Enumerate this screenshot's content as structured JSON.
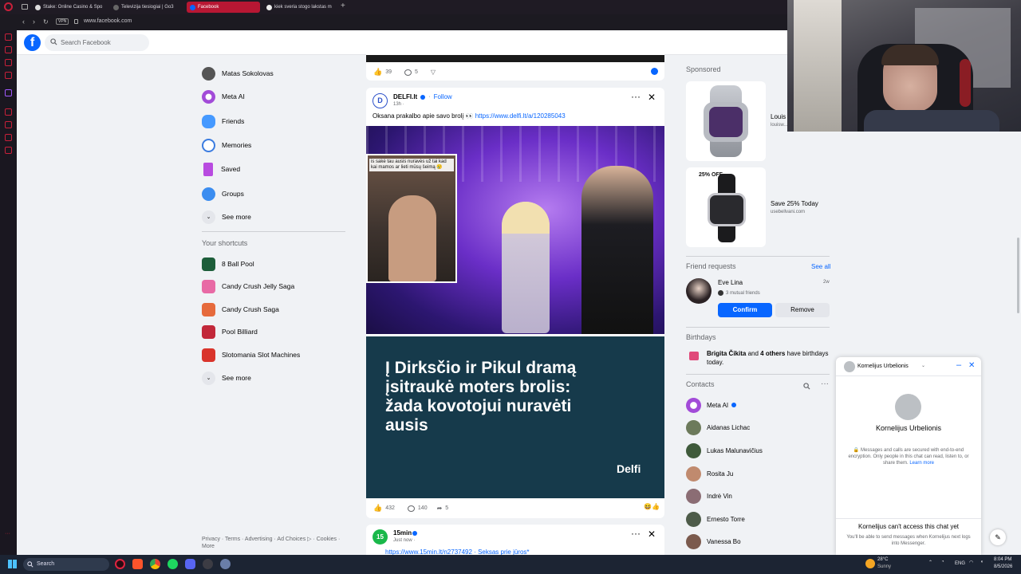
{
  "browser": {
    "tabs": [
      {
        "label": "Stake: Online Casino & Spo",
        "active": false
      },
      {
        "label": "Televizija tiesiogiai | Go3",
        "active": false
      },
      {
        "label": "Facebook",
        "active": true
      },
      {
        "label": "kiek sveria stogo lakstas m",
        "active": false
      }
    ],
    "new_tab": "+",
    "vpn": "VPN",
    "url": "www.facebook.com"
  },
  "facebook": {
    "logo": "f",
    "search_placeholder": "Search Facebook",
    "nav_icons": [
      "home-icon",
      "video-icon",
      "marketplace-icon",
      "groups-icon",
      "gaming-icon"
    ],
    "left_nav": [
      {
        "label": "Matas Sokolovas",
        "icon": "profile-avatar"
      },
      {
        "label": "Meta AI",
        "icon": "meta-ai-icon"
      },
      {
        "label": "Friends",
        "icon": "friends-icon"
      },
      {
        "label": "Memories",
        "icon": "memories-icon"
      },
      {
        "label": "Saved",
        "icon": "saved-icon"
      },
      {
        "label": "Groups",
        "icon": "groups-icon"
      },
      {
        "label": "See more",
        "icon": "chevron-down-icon"
      }
    ],
    "shortcuts_title": "Your shortcuts",
    "shortcuts": [
      {
        "label": "8 Ball Pool"
      },
      {
        "label": "Candy Crush Jelly Saga"
      },
      {
        "label": "Candy Crush Saga"
      },
      {
        "label": "Pool Billiard"
      },
      {
        "label": "Slotomania Slot Machines"
      },
      {
        "label": "See more"
      }
    ],
    "footer": "Privacy · Terms · Advertising · Ad Choices ▷ · Cookies · More",
    "prev_post": {
      "likes": "39",
      "comments": "5"
    },
    "post": {
      "author": "DELFI.lt",
      "follow": "Follow",
      "time": "13h ·",
      "text": "Oksana prakalbo apie savo brolį 👀",
      "link": "https://www.delfi.lt/a/120285043",
      "overlay_text": "is sakė tau ausis nuravės už tai kad kai mamos ar lieti mūsų šeimą 😢",
      "headline": "Į Dirksčio ir Pikul dramą įsitraukė moters brolis: žada kovotojui nuravėti ausis",
      "brand": "Delfi",
      "likes": "432",
      "comments": "140",
      "shares": "5"
    },
    "next_post": {
      "author": "15min",
      "time": "Just now ·",
      "text": "https://www.15min.lt/n2737492 · Seksas prie jūros*"
    },
    "sponsored_title": "Sponsored",
    "ads": [
      {
        "name": "Louis",
        "url": "louisw..."
      },
      {
        "name": "Save 25% Today",
        "url": "usebellvani.com",
        "badge": "25% OFF"
      }
    ],
    "friend_requests": {
      "title": "Friend requests",
      "see_all": "See all",
      "name": "Eve Lina",
      "time": "2w",
      "mutual": "3 mutual friends",
      "confirm": "Confirm",
      "remove": "Remove"
    },
    "birthdays": {
      "title": "Birthdays",
      "name": "Brigita Čikita",
      "rest": " and ",
      "others": "4 others",
      "tail": " have birthdays today."
    },
    "contacts_title": "Contacts",
    "contacts": [
      {
        "name": "Meta AI",
        "color": "#a24bd8"
      },
      {
        "name": "Aidanas Lichac",
        "color": "#6c7a5b"
      },
      {
        "name": "Lukas Malunavičius",
        "color": "#3f5a3b"
      },
      {
        "name": "Rosita Ju",
        "color": "#c08a6e"
      },
      {
        "name": "Indrė Vin",
        "color": "#8b6d74"
      },
      {
        "name": "Ernesto Torre",
        "color": "#4d5b49"
      },
      {
        "name": "Vanessa Bo",
        "color": "#7b5a4d"
      }
    ],
    "chat": {
      "header_name": "Kornelijus Urbelionis",
      "name": "Kornelijus Urbelionis",
      "secure_text": "Messages and calls are secured with end-to-end encryption. Only people in this chat can read, listen to, or share them.",
      "learn_more": "Learn more",
      "cant_access": "Kornelijus can't access this chat yet",
      "cant_sub": "You'll be able to send messages when Kornelijus next logs into Messenger."
    }
  },
  "taskbar": {
    "search": "Search",
    "weather_temp": "28°C",
    "weather_desc": "Sunny",
    "lang": "ENG",
    "time": "8:04 PM",
    "date": "8/5/2026"
  },
  "colors": {
    "fb_blue": "#0866ff",
    "opera_red": "#b81733",
    "post_dark": "#163a4b"
  }
}
